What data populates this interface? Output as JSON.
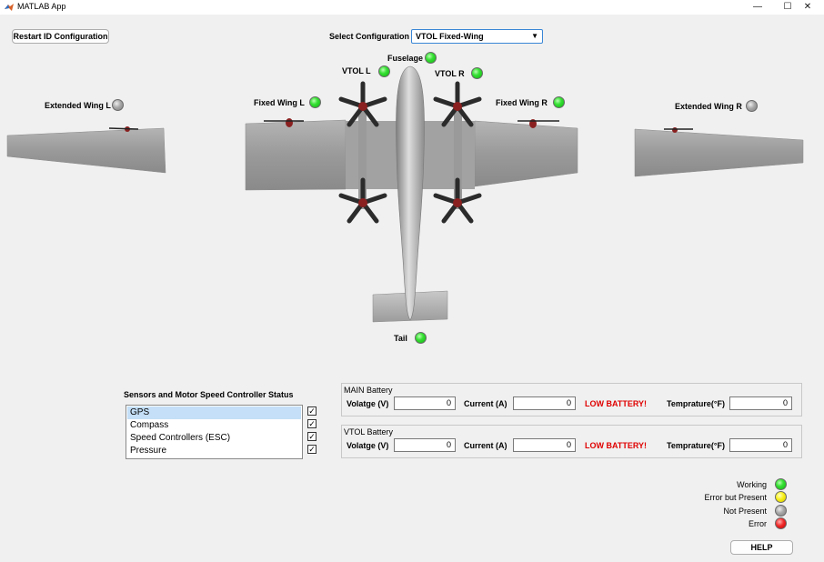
{
  "window": {
    "title": "MATLAB App",
    "minimize": "—",
    "maximize": "☐",
    "close": "✕"
  },
  "toolbar": {
    "restart_button": "Restart ID Configuration",
    "select_label": "Select Configuration",
    "select_value": "VTOL Fixed-Wing",
    "select_arrow": "▼"
  },
  "parts": {
    "fuselage": {
      "label": "Fuselage",
      "status": "green"
    },
    "vtol_l": {
      "label": "VTOL L",
      "status": "green"
    },
    "vtol_r": {
      "label": "VTOL R",
      "status": "green"
    },
    "fixed_wing_l": {
      "label": "Fixed Wing L",
      "status": "green"
    },
    "fixed_wing_r": {
      "label": "Fixed Wing R",
      "status": "green"
    },
    "extended_wing_l": {
      "label": "Extended Wing L",
      "status": "gray"
    },
    "extended_wing_r": {
      "label": "Extended Wing R",
      "status": "gray"
    },
    "tail": {
      "label": "Tail",
      "status": "green"
    }
  },
  "sensors": {
    "title": "Sensors and Motor Speed Controller Status",
    "items": [
      {
        "label": "GPS",
        "checked": true
      },
      {
        "label": "Compass",
        "checked": true
      },
      {
        "label": "Speed Controllers (ESC)",
        "checked": true
      },
      {
        "label": "Pressure",
        "checked": true
      }
    ],
    "check_glyph": "✓"
  },
  "batteries": [
    {
      "title": "MAIN Battery",
      "voltage_label": "Volatge (V)",
      "voltage": "0",
      "current_label": "Current (A)",
      "current": "0",
      "warning": "LOW BATTERY!",
      "temp_label": "Temprature(°F)",
      "temp": "0"
    },
    {
      "title": "VTOL Battery",
      "voltage_label": "Volatge (V)",
      "voltage": "0",
      "current_label": "Current (A)",
      "current": "0",
      "warning": "LOW BATTERY!",
      "temp_label": "Temprature(°F)",
      "temp": "0"
    }
  ],
  "legend": {
    "working": "Working",
    "error_present": "Error but Present",
    "not_present": "Not Present",
    "error": "Error"
  },
  "help_button": "HELP",
  "colors": {
    "working": "#22cc22",
    "error_present": "#f0e814",
    "not_present": "#9a9a9a",
    "error": "#e01010",
    "warning_text": "#e00000"
  }
}
